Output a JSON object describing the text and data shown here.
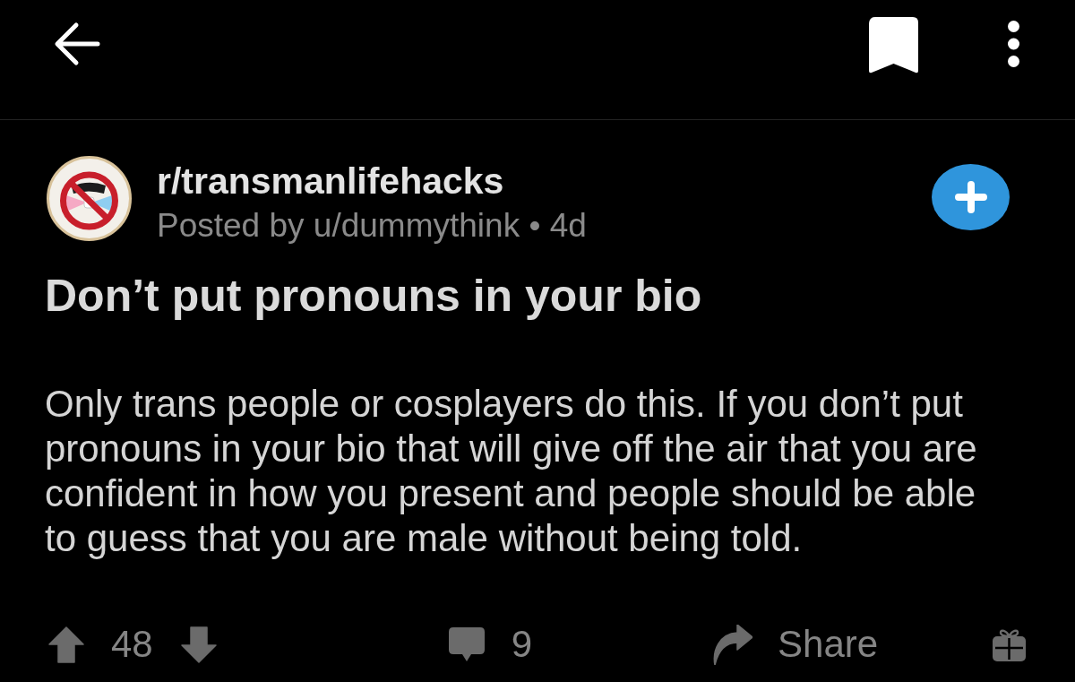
{
  "post": {
    "subreddit": "r/transmanlifehacks",
    "byline": "Posted by u/dummythink • 4d",
    "joined": false,
    "title": "Don’t put pronouns in your bio",
    "body": "Only trans people or cosplayers do this. If you don’t put pronouns in your bio that will give off the air that you are confident in how you present and people should be able to guess that you are male without being told."
  },
  "actions": {
    "upvoted": false,
    "score": "48",
    "downvoted": false,
    "comments": "9",
    "share": "Share"
  }
}
